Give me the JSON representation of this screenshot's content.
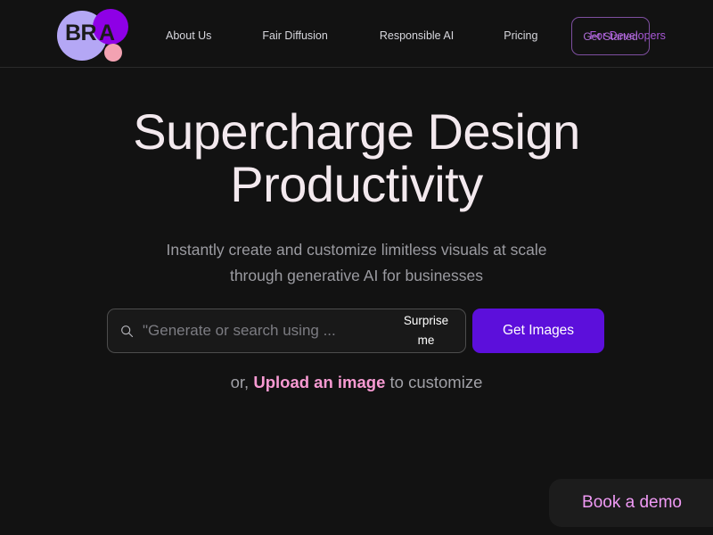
{
  "colors": {
    "background": "#121212",
    "headline_text": "#f3e9ee",
    "body_text": "#9b9ba1",
    "accent_purple": "#a857d6",
    "button_purple": "#5c0fdb",
    "accent_pink": "#f79ad2",
    "logo_periwinkle": "#b4a7f5",
    "logo_violet": "#8e00e6",
    "logo_pink_dot": "#f3a2b2",
    "demo_pink": "#f09af5",
    "border_outline": "#7e4fa0"
  },
  "header": {
    "logo": {
      "name": "bria-logo",
      "text_primary": "BR",
      "text_accent": "A"
    },
    "nav": [
      {
        "label": "About Us",
        "name": "nav-about-us",
        "accent": false
      },
      {
        "label": "Fair Diffusion",
        "name": "nav-fair-diffusion",
        "accent": false
      },
      {
        "label": "Responsible AI",
        "name": "nav-responsible-ai",
        "accent": false
      },
      {
        "label": "Pricing",
        "name": "nav-pricing",
        "accent": false
      },
      {
        "label": "For Developers",
        "name": "nav-for-developers",
        "accent": true
      }
    ],
    "cta_label": "Get Started"
  },
  "hero": {
    "headline_line1": "Supercharge Design",
    "headline_line2": "Productivity",
    "subtitle_line1": "Instantly create and customize limitless visuals at scale",
    "subtitle_line2": "through generative AI for businesses"
  },
  "search": {
    "icon": "search-icon",
    "placeholder": "\"Generate or search using ...",
    "value": "",
    "surprise_label": "Surprise me",
    "submit_label": "Get Images"
  },
  "upload": {
    "prefix": "or, ",
    "link_label": "Upload an image",
    "suffix": " to customize"
  },
  "book_demo": {
    "label": "Book a demo"
  }
}
